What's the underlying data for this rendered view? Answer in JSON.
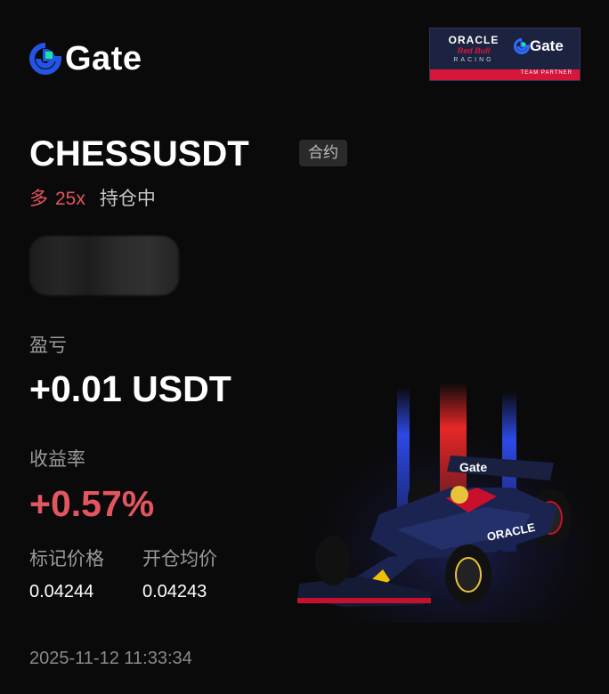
{
  "brand": {
    "name": "Gate"
  },
  "partner": {
    "line1": "ORACLE",
    "line2": "Red Bull",
    "line3": "RACING",
    "brand": "Gate",
    "footer": "TEAM PARTNER"
  },
  "position": {
    "symbol": "CHESSUSDT",
    "type_tag": "合约",
    "side": "多",
    "leverage": "25x",
    "status": "持仓中"
  },
  "pnl": {
    "label": "盈亏",
    "value": "+0.01 USDT"
  },
  "roi": {
    "label": "收益率",
    "value": "+0.57%"
  },
  "mark_price": {
    "label": "标记价格",
    "value": "0.04244"
  },
  "entry_price": {
    "label": "开仓均价",
    "value": "0.04243"
  },
  "timestamp": "2025-11-12 11:33:34",
  "colors": {
    "positive": "#e35560",
    "background": "#0a0a0a",
    "brand_blue": "#2354e6",
    "brand_green": "#17e6a1"
  }
}
